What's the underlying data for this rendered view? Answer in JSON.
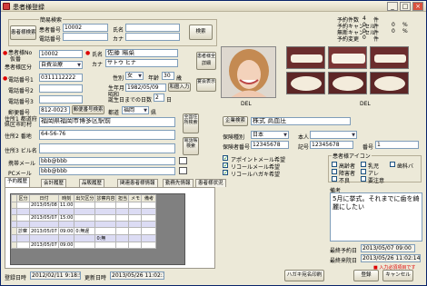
{
  "window": {
    "title": "患者様登録",
    "minimize": "_",
    "maximize": "□",
    "close": "×"
  },
  "search_group": {
    "label": "簡易検索",
    "button": "患者様検索",
    "patient_no_label": "患者番号",
    "patient_no": "10002",
    "phone_label": "電話番号",
    "name_label": "氏名",
    "kana_label": "カナ",
    "search_button": "検索"
  },
  "patient": {
    "no_label": "患者様No",
    "no_sub_label": "仮番",
    "no": "10002",
    "name_label": "氏名",
    "name": "佐藤 陽菜",
    "kana_label": "カナ",
    "kana": "サトウ ヒナ",
    "category_label": "患者様区分",
    "category": "自費治療",
    "sex_label": "性別",
    "sex": "女",
    "age_label": "年齢",
    "age": "30",
    "age_unit": "歳",
    "birth_label": "生年月日",
    "birth_era": "昭和",
    "birthdate": "1982/05/09",
    "birth_button": "和暦入力",
    "first_visit_label": "誕生日までの日数",
    "days_to_birthday": "2",
    "days_unit": "日",
    "phone1_label": "電話番号1",
    "phone1": "0311112222",
    "phone2_label": "電話番号2",
    "phone3_label": "電話番号3",
    "postal_label": "郵便番号",
    "postal": "812-0023",
    "postal_button": "郵便番号検索",
    "pref_label": "都道",
    "pref": "福岡",
    "pref_suffix": "県",
    "address1_label": "住所1 都道府県区市町村",
    "address1": "福岡県福岡市博多区駅前",
    "address2_label": "住所2 番地",
    "address2": "64-56-76",
    "address3_label": "住所3 ビル名",
    "mobile_label": "携帯メール",
    "mobile": "bbb@bbb",
    "pcmail_label": "PCメール",
    "pcmail": "bbb@bbb"
  },
  "side_buttons": {
    "all_register": "患者様全詳細",
    "all_register2": "全国住所検索",
    "special": "宴会表示",
    "vertical1": "全国住所検索",
    "vertical2": "電話帳検索"
  },
  "stats": {
    "rows": [
      {
        "label": "予約件数",
        "value": "4",
        "unit": "件",
        "pct_label": "予約キャンセル",
        "pct": "0"
      },
      {
        "label": "来院キャンセル",
        "value": "0",
        "unit": "件",
        "pct": "0"
      },
      {
        "label": "無断キャンセル",
        "value": "0",
        "unit": "件",
        "pct": "0"
      },
      {
        "label": "予約変更",
        "value": "0",
        "unit": "件"
      }
    ],
    "pct_unit": "%",
    "del_label": "DEL"
  },
  "insurance": {
    "company_button": "企業検索",
    "company": "株式 高血圧",
    "type_label": "保険種別",
    "type": "日本",
    "type2_label": "本人",
    "number_label": "保険者番号",
    "number": "12345678",
    "mark_label": "記号",
    "mark": "12345678",
    "no_label": "番号",
    "no": "1"
  },
  "checks": [
    {
      "label": "アポイントメール希望",
      "checked": "✓"
    },
    {
      "label": "リコールメール希望",
      "checked": "✓"
    },
    {
      "label": "リコールハガキ希望",
      "checked": "✓"
    }
  ],
  "patient_icons": {
    "label": "患者様アイコン",
    "items": [
      "高齢者",
      "乳児",
      "歯科バ",
      "障害者",
      "アレ",
      "",
      "不良",
      "要注意"
    ]
  },
  "tabs": [
    "予約履歴",
    "会計履歴",
    "品販履歴",
    "関連患者様情報",
    "勤務先情報",
    "患者様状況"
  ],
  "grid": {
    "headers": [
      "区分",
      "日付",
      "時刻",
      "出欠区分",
      "診察内容",
      "担当",
      "メモ",
      "備考"
    ],
    "rows": [
      [
        "",
        "2013/05/08",
        "11:00",
        "",
        "",
        "",
        "",
        ""
      ],
      [
        "",
        "",
        "",
        "",
        "",
        "",
        "",
        ""
      ],
      [
        "",
        "2013/05/07",
        "15:00",
        "",
        "",
        "",
        "",
        ""
      ],
      [
        "",
        "",
        "",
        "",
        "",
        "",
        "",
        ""
      ],
      [
        "診察",
        "2013/05/07",
        "09:00",
        "0:無遅",
        "",
        "",
        "",
        ""
      ],
      [
        "",
        "",
        "",
        "",
        "0:無",
        "",
        "",
        ""
      ],
      [
        "",
        "2013/05/07",
        "09:00",
        "",
        "",
        "",
        "",
        ""
      ]
    ]
  },
  "memo": {
    "label": "備考",
    "text": "5月に挙式。それまでに歯を綺麗にしたい"
  },
  "visit_info": {
    "last_reserve_label": "最終予約日",
    "last_reserve": "2013/05/07 09:00",
    "last_visit_label": "最終来院日",
    "last_visit": "2013/05/26 11:02:14",
    "required_note": "■ 入力必須項目です"
  },
  "footer": {
    "created_label": "登録日時",
    "created": "2012/02/11 9:18:55",
    "updated_label": "更新日時",
    "updated": "2013/05/26 11:02:14",
    "print_button": "ハガキ宛名印刷",
    "save_button": "登録",
    "cancel_button": "キャンセル"
  }
}
